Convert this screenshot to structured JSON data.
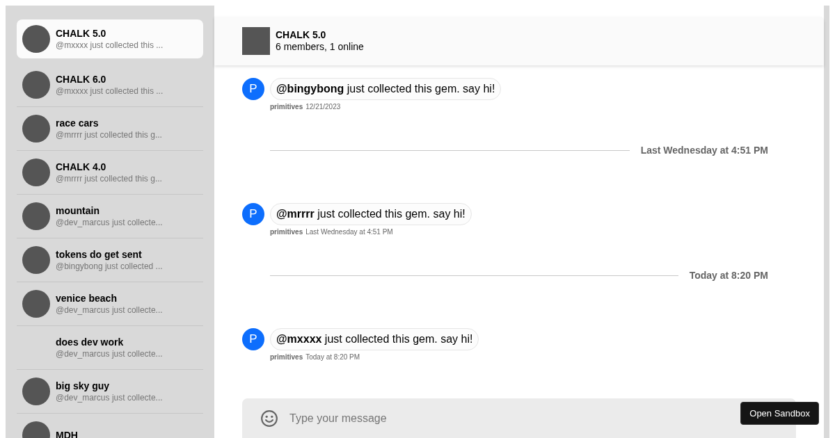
{
  "sidebar": {
    "items": [
      {
        "name": "CHALK 5.0",
        "preview": "@mxxxx just collected this ...",
        "avatar": true,
        "selected": true
      },
      {
        "name": "CHALK 6.0",
        "preview": "@mxxxx just collected this ...",
        "avatar": true,
        "selected": false
      },
      {
        "name": "race cars",
        "preview": "@mrrrr just collected this g...",
        "avatar": true,
        "selected": false
      },
      {
        "name": "CHALK 4.0",
        "preview": "@mrrrr just collected this g...",
        "avatar": true,
        "selected": false
      },
      {
        "name": "mountain",
        "preview": "@dev_marcus just collecte...",
        "avatar": true,
        "selected": false
      },
      {
        "name": "tokens do get sent",
        "preview": "@bingybong just collected ...",
        "avatar": true,
        "selected": false
      },
      {
        "name": "venice beach",
        "preview": "@dev_marcus just collecte...",
        "avatar": true,
        "selected": false
      },
      {
        "name": "does dev work",
        "preview": "@dev_marcus just collecte...",
        "avatar": false,
        "selected": false
      },
      {
        "name": "big sky guy",
        "preview": "@dev_marcus just collecte...",
        "avatar": true,
        "selected": false
      },
      {
        "name": "MDH",
        "avatar": true,
        "selected": false
      }
    ]
  },
  "header": {
    "title": "CHALK 5.0",
    "subtitle": "6 members, 1 online"
  },
  "feed": [
    {
      "kind": "message",
      "initial": "P",
      "text": "**@bingybong** just collected this gem. say hi!",
      "author": "primitives",
      "time": "12/21/2023"
    },
    {
      "kind": "divider",
      "label": "Last Wednesday at 4:51 PM"
    },
    {
      "kind": "message",
      "initial": "P",
      "text": "**@mrrrr** just collected this gem. say hi!",
      "author": "primitives",
      "time": "Last Wednesday at 4:51 PM"
    },
    {
      "kind": "divider",
      "label": "Today at 8:20 PM"
    },
    {
      "kind": "message",
      "initial": "P",
      "text": "**@mxxxx** just collected this gem. say hi!",
      "author": "primitives",
      "time": "Today at 8:20 PM"
    }
  ],
  "composer": {
    "placeholder": "Type your message"
  },
  "sandbox_button": "Open Sandbox"
}
